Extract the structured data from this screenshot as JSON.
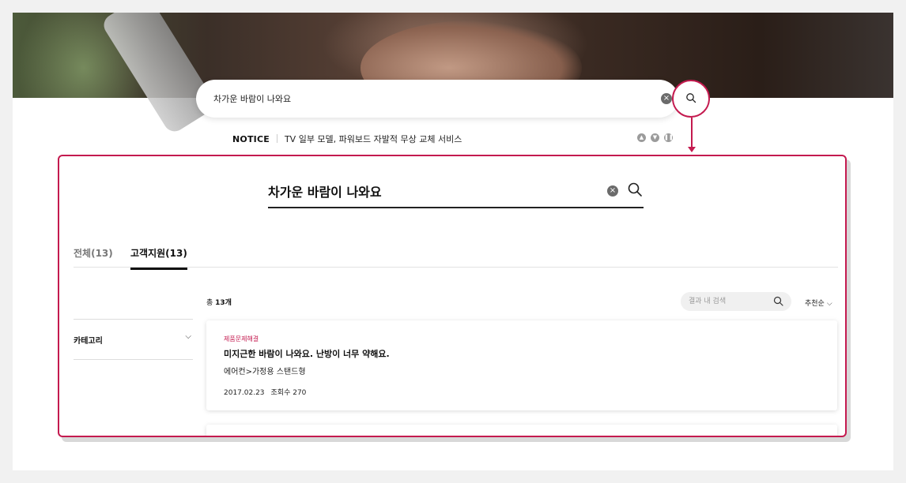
{
  "header_search": {
    "query": "차가운 바람이 나와요",
    "clear_symbol": "×"
  },
  "notice": {
    "label": "NOTICE",
    "text": "TV 일부 모델, 파워보드 자발적 무상 교체 서비스",
    "controls": [
      "up-icon",
      "down-icon",
      "pause-icon"
    ]
  },
  "panel": {
    "search": {
      "query": "차가운 바람이 나와요",
      "clear_symbol": "×"
    },
    "tabs": [
      {
        "label": "전체(13)",
        "active": false
      },
      {
        "label": "고객지원(13)",
        "active": true
      }
    ],
    "sidebar": {
      "category_label": "카테고리",
      "chevron": "⌵"
    },
    "results": {
      "total_prefix": "총",
      "total_count": "13개",
      "in_search_placeholder": "결과 내 검색",
      "sort_label": "추천순",
      "sort_chevron": "⌵",
      "items": [
        {
          "category": "제품문제해결",
          "title": "미지근한 바람이 나와요. 난방이 너무 약해요.",
          "path": "에어컨>가정용 스탠드형",
          "date": "2017.02.23",
          "views": "조회수 270"
        }
      ]
    }
  },
  "colors": {
    "accent": "#c41a4f",
    "background": "#f1f1f1"
  }
}
